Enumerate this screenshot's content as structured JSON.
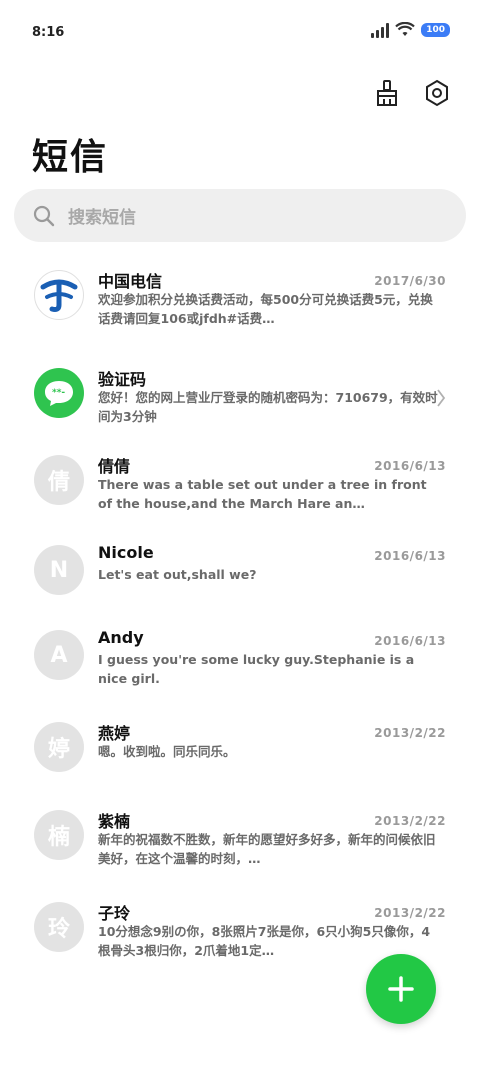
{
  "status_bar": {
    "time": "8:16",
    "battery": "100"
  },
  "header": {
    "title": "短信",
    "icons": [
      "broom-icon",
      "settings-icon"
    ]
  },
  "search": {
    "placeholder": "搜索短信"
  },
  "conversations": [
    {
      "name": "中国电信",
      "date": "2017/6/30",
      "preview": "欢迎参加积分兑换话费活动，每500分可兑换话费5元，兑换话费请回复106或jfdh#话费…",
      "avatar": "telecom-logo"
    },
    {
      "name": "验证码",
      "date": "",
      "preview": "您好！您的网上营业厅登录的随机密码为：710679，有效时间为3分钟",
      "avatar": "chat-bubble-icon"
    },
    {
      "name": "倩倩",
      "date": "2016/6/13",
      "preview": "There was a table set out under a tree in front of the house,and the March Hare an…",
      "avatar_text": "倩"
    },
    {
      "name": "Nicole",
      "date": "2016/6/13",
      "preview": "Let's eat out,shall we?",
      "avatar_text": "N"
    },
    {
      "name": "Andy",
      "date": "2016/6/13",
      "preview": "I guess you're some lucky guy.Stephanie is a nice girl.",
      "avatar_text": "A"
    },
    {
      "name": "燕婷",
      "date": "2013/2/22",
      "preview": "嗯。收到啦。同乐同乐。",
      "avatar_text": "婷"
    },
    {
      "name": "紫楠",
      "date": "2013/2/22",
      "preview": "新年的祝福数不胜数，新年的愿望好多好多，新年的问候依旧美好，在这个温馨的时刻，…",
      "avatar_text": "楠"
    },
    {
      "name": "子玲",
      "date": "2013/2/22",
      "preview": "10分想念9别の你，8张照片7张是你，6只小狗5只像你，4根骨头3根归你，2爪着地1定…",
      "avatar_text": "玲"
    }
  ],
  "fab": {
    "icon": "plus-icon"
  }
}
